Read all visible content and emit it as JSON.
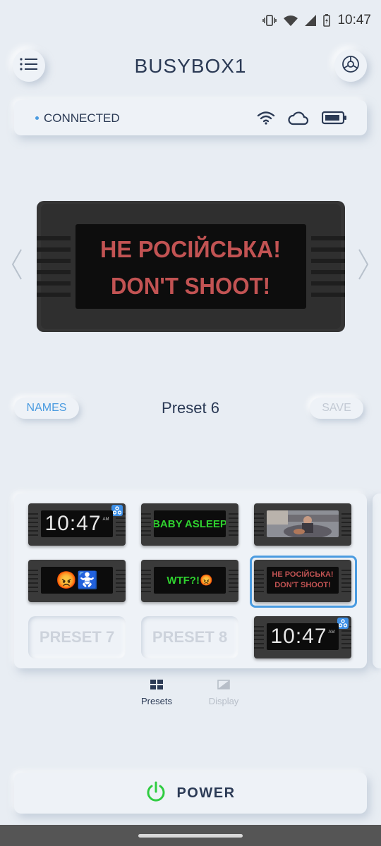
{
  "status_bar": {
    "time": "10:47"
  },
  "header": {
    "title": "BUSYBOX1",
    "menu_icon": "list-icon",
    "settings_icon": "gear-icon"
  },
  "connection": {
    "status": "CONNECTED",
    "icons": [
      "wifi-icon",
      "cloud-icon",
      "battery-icon"
    ]
  },
  "device": {
    "line1": "НЕ РОСІЙСЬКА!",
    "line2": "DON'T SHOOT!",
    "text_color": "#c25353"
  },
  "preset_bar": {
    "names_label": "NAMES",
    "preset_name": "Preset 6",
    "save_label": "SAVE"
  },
  "presets": [
    {
      "kind": "clock",
      "text": "10:47",
      "ampm": "AM"
    },
    {
      "kind": "text",
      "text": "BABY ASLEEP",
      "color": "#2fd12f"
    },
    {
      "kind": "photo"
    },
    {
      "kind": "emoji",
      "text": "😡🚼"
    },
    {
      "kind": "text",
      "text": "WTF?!😡",
      "color": "#2fd12f"
    },
    {
      "kind": "text2",
      "line1": "НЕ РОСІЙСЬКА!",
      "line2": "DON'T SHOOT!",
      "color": "#c25353",
      "selected": true
    },
    {
      "kind": "empty",
      "label": "PRESET 7"
    },
    {
      "kind": "empty",
      "label": "PRESET 8"
    },
    {
      "kind": "clock",
      "text": "10:47",
      "ampm": "AM"
    }
  ],
  "nav": {
    "tab1": "Presets",
    "tab2": "Display"
  },
  "power": {
    "label": "POWER",
    "accent": "#2ecc40"
  }
}
